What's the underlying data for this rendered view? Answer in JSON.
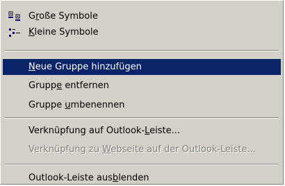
{
  "menu": {
    "items": [
      {
        "pre": "G",
        "acc": "r",
        "post": "oße Symbole",
        "icon": "large-icons-icon"
      },
      {
        "pre": "",
        "acc": "K",
        "post": "leine Symbole",
        "icon": "small-icons-icon"
      },
      {
        "pre": "",
        "acc": "N",
        "post": "eue Gruppe hinzufügen"
      },
      {
        "pre": "Grupp",
        "acc": "e",
        "post": " entfernen"
      },
      {
        "pre": "Gruppe ",
        "acc": "u",
        "post": "mbenennen"
      },
      {
        "pre": "Verknüpfung auf Outlook-",
        "acc": "L",
        "post": "eiste..."
      },
      {
        "pre": "Verknüpfung zu ",
        "acc": "W",
        "post": "ebseite auf der Outlook-Leiste..."
      },
      {
        "pre": "Outlook-Leiste aus",
        "acc": "b",
        "post": "lenden"
      }
    ],
    "highlight_color": "#0a246a",
    "menu_background": "#d4d0c8"
  }
}
